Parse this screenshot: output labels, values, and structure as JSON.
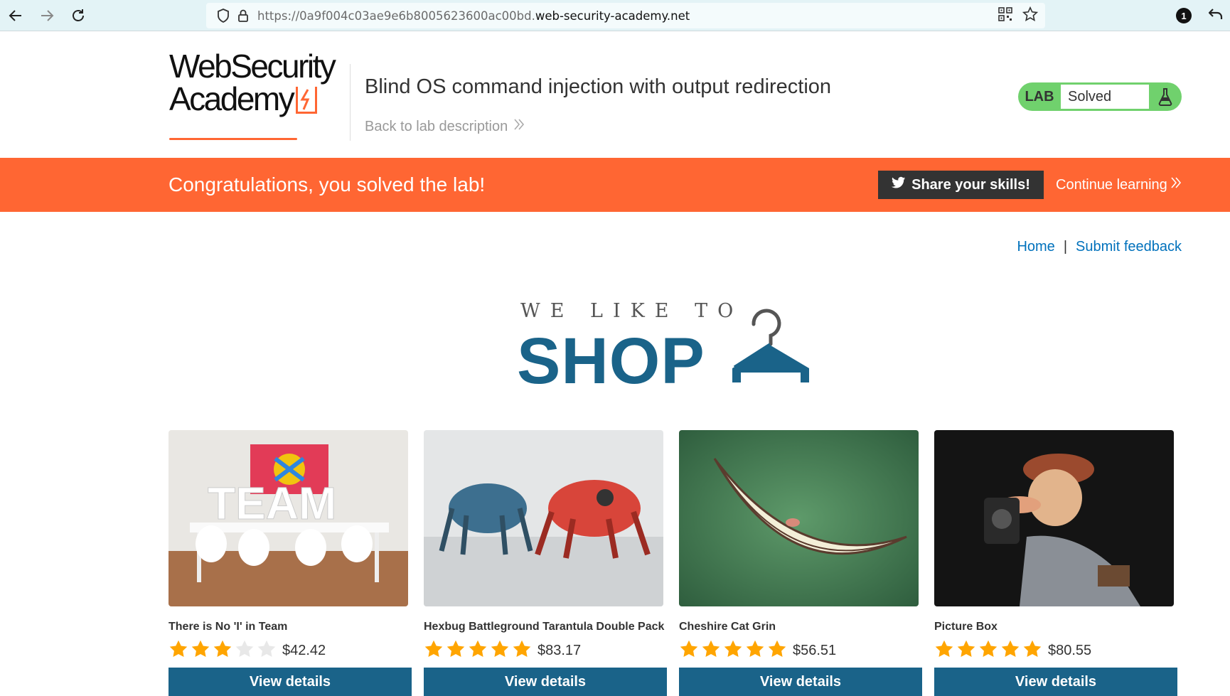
{
  "browser": {
    "url_prefix": "https://0a9f004c03ae9e6b8005623600ac00bd.",
    "url_host": "web-security-academy.net",
    "extension_badge": "1"
  },
  "header": {
    "logo_line1": "WebSecurity",
    "logo_line2": "Academy",
    "lab_title": "Blind OS command injection with output redirection",
    "back_link": "Back to lab description",
    "status_tag": "LAB",
    "status_text": "Solved",
    "status_color": "#70d16d"
  },
  "banner": {
    "message": "Congratulations, you solved the lab!",
    "share_label": "Share your skills!",
    "continue_label": "Continue learning",
    "color": "#ff6633"
  },
  "nav": {
    "home": "Home",
    "separator": "|",
    "feedback": "Submit feedback"
  },
  "hero": {
    "small": "WE LIKE TO",
    "big": "SHOP"
  },
  "products": [
    {
      "name": "There is No 'I' in Team",
      "rating": 3,
      "price": "$42.42",
      "button": "View details"
    },
    {
      "name": "Hexbug Battleground Tarantula Double Pack",
      "rating": 5,
      "price": "$83.17",
      "button": "View details"
    },
    {
      "name": "Cheshire Cat Grin",
      "rating": 5,
      "price": "$56.51",
      "button": "View details"
    },
    {
      "name": "Picture Box",
      "rating": 5,
      "price": "$80.55",
      "button": "View details"
    }
  ]
}
